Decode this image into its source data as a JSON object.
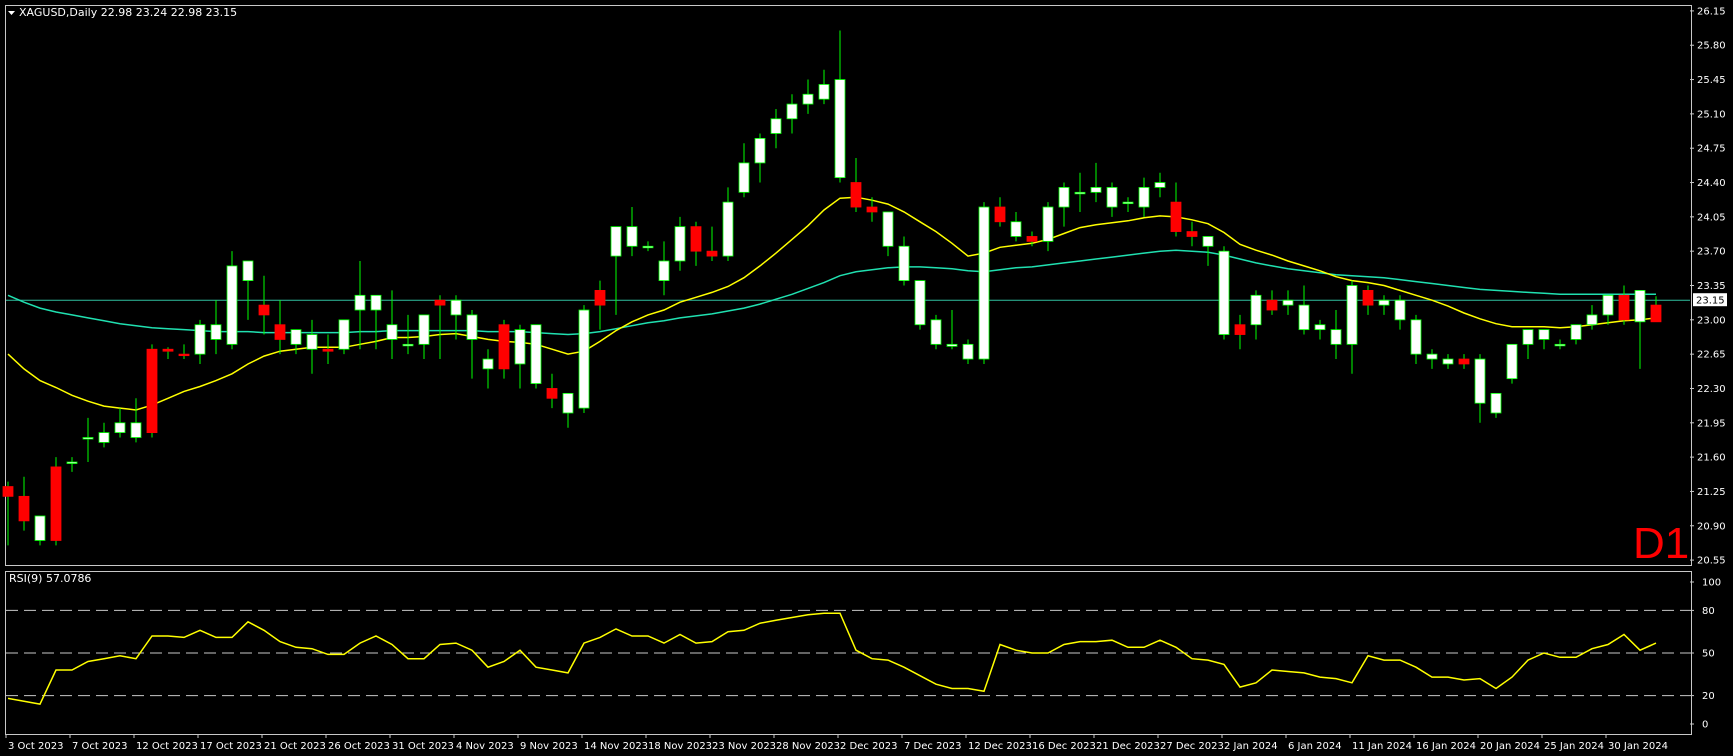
{
  "header": {
    "symbol_line": "XAGUSD,Daily  22.98 23.24 22.98 23.15"
  },
  "rsi_header": "RSI(9) 57.0786",
  "timeframe_badge": "D1",
  "current_price_label": "23.15",
  "colors": {
    "background": "#000000",
    "frame": "#c8c8c8",
    "bull_candle": "#ffffff",
    "bear_candle": "#ff0000",
    "wick": "#00ff00",
    "ma_fast": "#ffff00",
    "ma_slow": "#20e0b0",
    "rsi_line": "#ffff00",
    "badge": "#ff0000"
  },
  "chart_data": [
    {
      "type": "candlestick",
      "title": "XAGUSD,Daily",
      "ylim": [
        20.5,
        26.2
      ],
      "y_ticks": [
        "26.15",
        "25.80",
        "25.45",
        "25.10",
        "24.75",
        "24.40",
        "24.05",
        "23.70",
        "23.35",
        "23.00",
        "22.65",
        "22.30",
        "21.95",
        "21.60",
        "21.25",
        "20.90",
        "20.55"
      ],
      "x_ticks": [
        "3 Oct 2023",
        "7 Oct 2023",
        "12 Oct 2023",
        "17 Oct 2023",
        "21 Oct 2023",
        "26 Oct 2023",
        "31 Oct 2023",
        "4 Nov 2023",
        "9 Nov 2023",
        "14 Nov 2023",
        "18 Nov 2023",
        "23 Nov 2023",
        "28 Nov 2023",
        "2 Dec 2023",
        "7 Dec 2023",
        "12 Dec 2023",
        "16 Dec 2023",
        "21 Dec 2023",
        "27 Dec 2023",
        "2 Jan 2024",
        "6 Jan 2024",
        "11 Jan 2024",
        "16 Jan 2024",
        "20 Jan 2024",
        "25 Jan 2024",
        "30 Jan 2024"
      ],
      "ohlc": [
        [
          21.3,
          21.35,
          20.7,
          21.2
        ],
        [
          21.2,
          21.4,
          20.85,
          20.95
        ],
        [
          20.75,
          21.0,
          20.7,
          21.0
        ],
        [
          21.5,
          21.6,
          20.7,
          20.75
        ],
        [
          21.55,
          21.6,
          21.45,
          21.55
        ],
        [
          21.8,
          22.0,
          21.55,
          21.8
        ],
        [
          21.75,
          21.95,
          21.7,
          21.85
        ],
        [
          21.85,
          22.1,
          21.8,
          21.95
        ],
        [
          21.8,
          22.2,
          21.75,
          21.95
        ],
        [
          22.7,
          22.75,
          21.8,
          21.85
        ],
        [
          22.7,
          22.72,
          22.6,
          22.68
        ],
        [
          22.65,
          22.75,
          22.6,
          22.64
        ],
        [
          22.65,
          23.0,
          22.55,
          22.95
        ],
        [
          22.8,
          23.2,
          22.65,
          22.95
        ],
        [
          22.75,
          23.7,
          22.7,
          23.55
        ],
        [
          23.4,
          23.6,
          23.0,
          23.6
        ],
        [
          23.15,
          23.45,
          22.85,
          23.05
        ],
        [
          22.95,
          23.2,
          22.65,
          22.8
        ],
        [
          22.75,
          22.9,
          22.65,
          22.9
        ],
        [
          22.7,
          23.0,
          22.45,
          22.85
        ],
        [
          22.7,
          22.85,
          22.55,
          22.68
        ],
        [
          22.7,
          23.0,
          22.65,
          23.0
        ],
        [
          23.1,
          23.6,
          22.7,
          23.25
        ],
        [
          23.1,
          23.2,
          22.7,
          23.25
        ],
        [
          22.8,
          23.3,
          22.6,
          22.95
        ],
        [
          22.75,
          23.05,
          22.65,
          22.75
        ],
        [
          22.75,
          23.05,
          22.6,
          23.05
        ],
        [
          23.2,
          23.25,
          22.6,
          23.15
        ],
        [
          23.05,
          23.25,
          22.8,
          23.2
        ],
        [
          22.8,
          23.1,
          22.4,
          23.05
        ],
        [
          22.5,
          22.7,
          22.3,
          22.6
        ],
        [
          22.95,
          23.0,
          22.4,
          22.5
        ],
        [
          22.55,
          22.95,
          22.3,
          22.9
        ],
        [
          22.35,
          22.9,
          22.3,
          22.95
        ],
        [
          22.3,
          22.45,
          22.1,
          22.2
        ],
        [
          22.05,
          22.2,
          21.9,
          22.25
        ],
        [
          22.1,
          23.15,
          22.05,
          23.1
        ],
        [
          23.3,
          23.4,
          22.9,
          23.15
        ],
        [
          23.65,
          23.75,
          23.05,
          23.95
        ],
        [
          23.75,
          24.15,
          23.65,
          23.95
        ],
        [
          23.75,
          23.8,
          23.7,
          23.75
        ],
        [
          23.4,
          23.8,
          23.25,
          23.6
        ],
        [
          23.6,
          24.05,
          23.5,
          23.95
        ],
        [
          23.95,
          24.0,
          23.55,
          23.7
        ],
        [
          23.7,
          23.95,
          23.6,
          23.65
        ],
        [
          23.65,
          24.35,
          23.6,
          24.2
        ],
        [
          24.3,
          24.8,
          24.25,
          24.6
        ],
        [
          24.6,
          24.9,
          24.4,
          24.85
        ],
        [
          24.9,
          25.15,
          24.75,
          25.05
        ],
        [
          25.05,
          25.3,
          24.9,
          25.2
        ],
        [
          25.2,
          25.45,
          25.1,
          25.3
        ],
        [
          25.25,
          25.55,
          25.2,
          25.4
        ],
        [
          24.45,
          25.95,
          24.4,
          25.45
        ],
        [
          24.4,
          24.65,
          24.1,
          24.15
        ],
        [
          24.15,
          24.25,
          24.0,
          24.1
        ],
        [
          23.75,
          24.1,
          23.65,
          24.1
        ],
        [
          23.4,
          23.85,
          23.35,
          23.75
        ],
        [
          22.95,
          23.4,
          22.9,
          23.4
        ],
        [
          22.75,
          23.05,
          22.7,
          23.0
        ],
        [
          22.73,
          23.1,
          22.7,
          22.75
        ],
        [
          22.6,
          22.8,
          22.55,
          22.75
        ],
        [
          22.6,
          24.2,
          22.55,
          24.15
        ],
        [
          24.15,
          24.25,
          23.95,
          24.0
        ],
        [
          23.85,
          24.1,
          23.8,
          24.0
        ],
        [
          23.85,
          23.9,
          23.75,
          23.8
        ],
        [
          23.8,
          24.2,
          23.7,
          24.15
        ],
        [
          24.15,
          24.4,
          23.95,
          24.35
        ],
        [
          24.3,
          24.5,
          24.1,
          24.3
        ],
        [
          24.3,
          24.6,
          24.2,
          24.35
        ],
        [
          24.15,
          24.4,
          24.05,
          24.35
        ],
        [
          24.2,
          24.25,
          24.1,
          24.2
        ],
        [
          24.15,
          24.45,
          24.05,
          24.35
        ],
        [
          24.35,
          24.5,
          24.25,
          24.4
        ],
        [
          24.2,
          24.4,
          23.85,
          23.9
        ],
        [
          23.9,
          24.0,
          23.75,
          23.85
        ],
        [
          23.75,
          23.85,
          23.55,
          23.85
        ],
        [
          22.85,
          23.75,
          22.8,
          23.7
        ],
        [
          22.95,
          23.05,
          22.7,
          22.85
        ],
        [
          22.95,
          23.3,
          22.8,
          23.25
        ],
        [
          23.2,
          23.3,
          23.05,
          23.1
        ],
        [
          23.15,
          23.3,
          23.05,
          23.2
        ],
        [
          22.9,
          23.35,
          22.85,
          23.15
        ],
        [
          22.9,
          23.0,
          22.8,
          22.95
        ],
        [
          22.75,
          23.1,
          22.6,
          22.9
        ],
        [
          22.75,
          23.4,
          22.45,
          23.35
        ],
        [
          23.3,
          23.35,
          23.05,
          23.15
        ],
        [
          23.15,
          23.25,
          23.05,
          23.2
        ],
        [
          23.0,
          23.25,
          22.9,
          23.2
        ],
        [
          22.65,
          23.05,
          22.55,
          23.0
        ],
        [
          22.6,
          22.7,
          22.5,
          22.65
        ],
        [
          22.55,
          22.65,
          22.5,
          22.6
        ],
        [
          22.6,
          22.65,
          22.5,
          22.55
        ],
        [
          22.15,
          22.65,
          21.95,
          22.6
        ],
        [
          22.05,
          22.25,
          22.0,
          22.25
        ],
        [
          22.4,
          22.75,
          22.35,
          22.75
        ],
        [
          22.75,
          22.9,
          22.6,
          22.9
        ],
        [
          22.8,
          22.9,
          22.7,
          22.9
        ],
        [
          22.75,
          22.8,
          22.7,
          22.75
        ],
        [
          22.8,
          22.95,
          22.75,
          22.95
        ],
        [
          22.95,
          23.15,
          22.9,
          23.05
        ],
        [
          23.05,
          23.2,
          22.95,
          23.25
        ],
        [
          23.25,
          23.35,
          22.95,
          23.0
        ],
        [
          22.98,
          23.24,
          22.5,
          23.3
        ],
        [
          23.15,
          23.24,
          22.98,
          22.98
        ]
      ],
      "ma_fast": [
        22.65,
        22.5,
        22.38,
        22.31,
        22.23,
        22.17,
        22.12,
        22.1,
        22.08,
        22.13,
        22.2,
        22.27,
        22.32,
        22.38,
        22.45,
        22.55,
        22.63,
        22.68,
        22.7,
        22.72,
        22.72,
        22.72,
        22.75,
        22.78,
        22.82,
        22.82,
        22.83,
        22.85,
        22.86,
        22.83,
        22.8,
        22.78,
        22.77,
        22.75,
        22.7,
        22.65,
        22.68,
        22.78,
        22.89,
        22.98,
        23.05,
        23.1,
        23.18,
        23.23,
        23.28,
        23.34,
        23.43,
        23.55,
        23.68,
        23.82,
        23.96,
        24.12,
        24.24,
        24.25,
        24.22,
        24.18,
        24.1,
        24.0,
        23.9,
        23.78,
        23.65,
        23.68,
        23.74,
        23.76,
        23.78,
        23.82,
        23.88,
        23.94,
        23.97,
        23.99,
        24.01,
        24.04,
        24.06,
        24.05,
        24.02,
        23.98,
        23.89,
        23.77,
        23.71,
        23.66,
        23.6,
        23.55,
        23.5,
        23.44,
        23.4,
        23.38,
        23.35,
        23.3,
        23.25,
        23.2,
        23.14,
        23.07,
        23.01,
        22.96,
        22.93,
        22.93,
        22.93,
        22.92,
        22.93,
        22.95,
        22.97,
        22.99,
        23.0,
        23.02
      ],
      "ma_slow": [
        23.25,
        23.18,
        23.12,
        23.08,
        23.05,
        23.02,
        22.99,
        22.96,
        22.94,
        22.92,
        22.91,
        22.9,
        22.89,
        22.88,
        22.88,
        22.88,
        22.87,
        22.87,
        22.87,
        22.87,
        22.87,
        22.87,
        22.88,
        22.88,
        22.89,
        22.89,
        22.89,
        22.89,
        22.89,
        22.89,
        22.88,
        22.88,
        22.88,
        22.87,
        22.86,
        22.85,
        22.86,
        22.88,
        22.91,
        22.94,
        22.97,
        22.99,
        23.02,
        23.04,
        23.06,
        23.09,
        23.12,
        23.16,
        23.21,
        23.26,
        23.32,
        23.38,
        23.45,
        23.49,
        23.51,
        23.53,
        23.54,
        23.54,
        23.53,
        23.52,
        23.5,
        23.49,
        23.51,
        23.53,
        23.54,
        23.56,
        23.58,
        23.6,
        23.62,
        23.64,
        23.66,
        23.68,
        23.7,
        23.71,
        23.7,
        23.69,
        23.66,
        23.62,
        23.58,
        23.55,
        23.52,
        23.5,
        23.48,
        23.46,
        23.45,
        23.44,
        23.43,
        23.41,
        23.39,
        23.37,
        23.35,
        23.33,
        23.31,
        23.3,
        23.29,
        23.28,
        23.27,
        23.26,
        23.26,
        23.26,
        23.26,
        23.26,
        23.26,
        23.26
      ]
    },
    {
      "type": "line",
      "title": "RSI(9) 57.0786",
      "ylim": [
        0,
        100
      ],
      "y_ticks": [
        "100",
        "80",
        "50",
        "20",
        "0"
      ],
      "levels": [
        80,
        50,
        20
      ],
      "values": [
        18,
        16,
        14,
        38,
        38,
        44,
        46,
        48,
        46,
        62,
        62,
        61,
        66,
        61,
        61,
        72,
        66,
        58,
        54,
        53,
        49,
        49,
        57,
        62,
        56,
        46,
        46,
        56,
        57,
        52,
        40,
        44,
        52,
        40,
        38,
        36,
        57,
        61,
        67,
        62,
        62,
        57,
        63,
        57,
        58,
        65,
        66,
        71,
        73,
        75,
        77,
        78,
        78,
        52,
        46,
        45,
        40,
        34,
        28,
        25,
        25,
        23,
        56,
        52,
        50,
        50,
        56,
        58,
        58,
        59,
        54,
        54,
        59,
        54,
        46,
        45,
        42,
        26,
        29,
        38,
        37,
        36,
        33,
        32,
        29,
        48,
        45,
        45,
        40,
        33,
        33,
        31,
        32,
        25,
        33,
        45,
        50,
        47,
        47,
        53,
        56,
        63,
        52,
        57
      ]
    }
  ]
}
